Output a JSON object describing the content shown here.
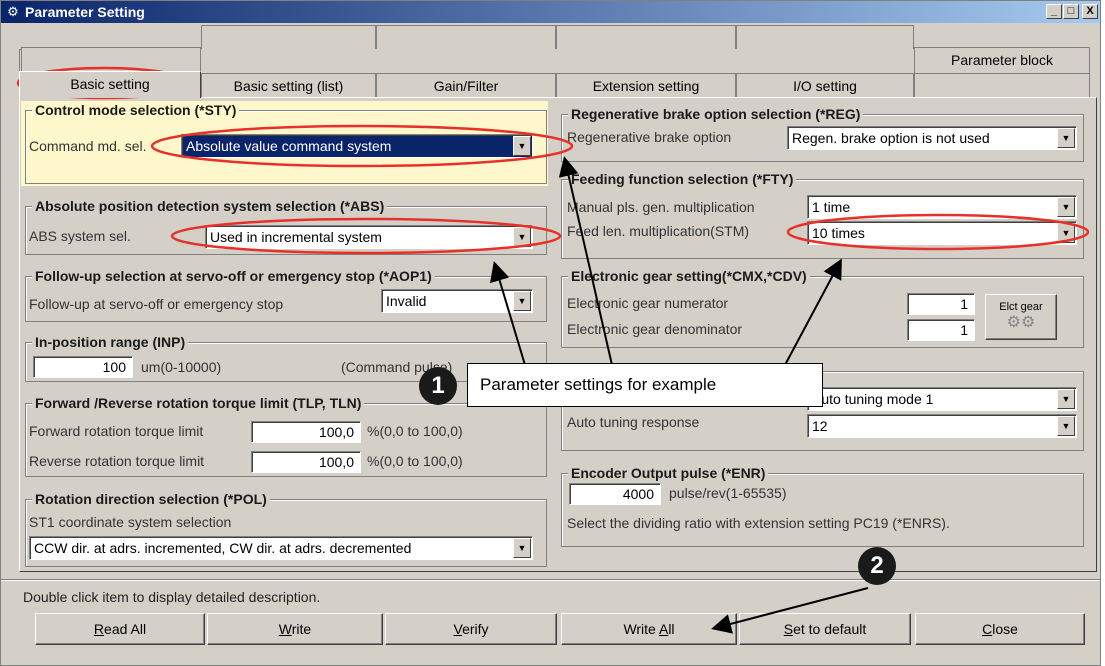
{
  "window": {
    "title": "Parameter Setting",
    "icon": "gear-pair-icon",
    "controls": {
      "minimize": "_",
      "maximize": "□",
      "close": "X"
    }
  },
  "tabs": {
    "top_row": [
      "Parameter block"
    ],
    "bottom_row": [
      "Basic setting",
      "Basic setting (list)",
      "Gain/Filter",
      "Extension setting",
      "I/O setting"
    ],
    "active": "Basic setting"
  },
  "control_mode": {
    "legend": "Control mode selection (*STY)",
    "label": "Command md. sel.",
    "value": "Absolute value command system"
  },
  "abs": {
    "legend": "Absolute position detection system selection (*ABS)",
    "label": "ABS system sel.",
    "value": "Used in incremental system"
  },
  "followup": {
    "legend": "Follow-up selection at servo-off or emergency stop (*AOP1)",
    "label": "Follow-up at servo-off or emergency stop",
    "value": "Invalid"
  },
  "inposition": {
    "legend": "In-position range (INP)",
    "value": "100",
    "range": "um(0-10000)",
    "unit_note": "(Command pulse)"
  },
  "torque": {
    "legend": "Forward /Reverse rotation torque limit (TLP, TLN)",
    "forward_label": "Forward rotation torque limit",
    "forward_value": "100,0",
    "forward_range": "%(0,0 to 100,0)",
    "reverse_label": "Reverse rotation torque limit",
    "reverse_value": "100,0",
    "reverse_range": "%(0,0 to 100,0)"
  },
  "rotation": {
    "legend": "Rotation direction selection (*POL)",
    "label": "ST1 coordinate system selection",
    "value": "CCW dir. at adrs. incremented, CW dir. at adrs. decremented"
  },
  "regen": {
    "legend": "Regenerative brake option selection (*REG)",
    "label": "Regenerative brake option",
    "value": "Regen. brake option is not used"
  },
  "feeding": {
    "legend": "Feeding function selection (*FTY)",
    "manual_label": "Manual pls. gen. multiplication",
    "manual_value": "1 time",
    "feed_label": "Feed len. multiplication(STM)",
    "feed_value": "10 times"
  },
  "gear": {
    "legend": "Electronic gear setting(*CMX,*CDV)",
    "numerator_label": "Electronic gear numerator",
    "numerator_value": "1",
    "denominator_label": "Electronic gear denominator",
    "denominator_value": "1",
    "button_label": "Elct gear"
  },
  "autotune": {
    "mode_value": "Auto tuning mode 1",
    "response_label": "Auto tuning response",
    "response_value": "12"
  },
  "encoder": {
    "legend": "Encoder Output pulse (*ENR)",
    "value": "4000",
    "range": "pulse/rev(1-65535)",
    "note": "Select the dividing ratio with extension setting PC19 (*ENRS)."
  },
  "footer": {
    "hint": "Double click item to display detailed description.",
    "buttons": {
      "read_all": {
        "prefix": "",
        "key": "R",
        "suffix": "ead All"
      },
      "write": {
        "prefix": "",
        "key": "W",
        "suffix": "rite"
      },
      "verify": {
        "prefix": "",
        "key": "V",
        "suffix": "erify"
      },
      "write_all": {
        "prefix": "Write ",
        "key": "A",
        "suffix": "ll"
      },
      "set_default": {
        "prefix": "",
        "key": "S",
        "suffix": "et to default"
      },
      "close": {
        "prefix": "",
        "key": "C",
        "suffix": "lose"
      }
    }
  },
  "annotations": {
    "callout_text": "Parameter settings for example",
    "badge1": "1",
    "badge2": "2",
    "highlight_color": "#e8302a"
  }
}
